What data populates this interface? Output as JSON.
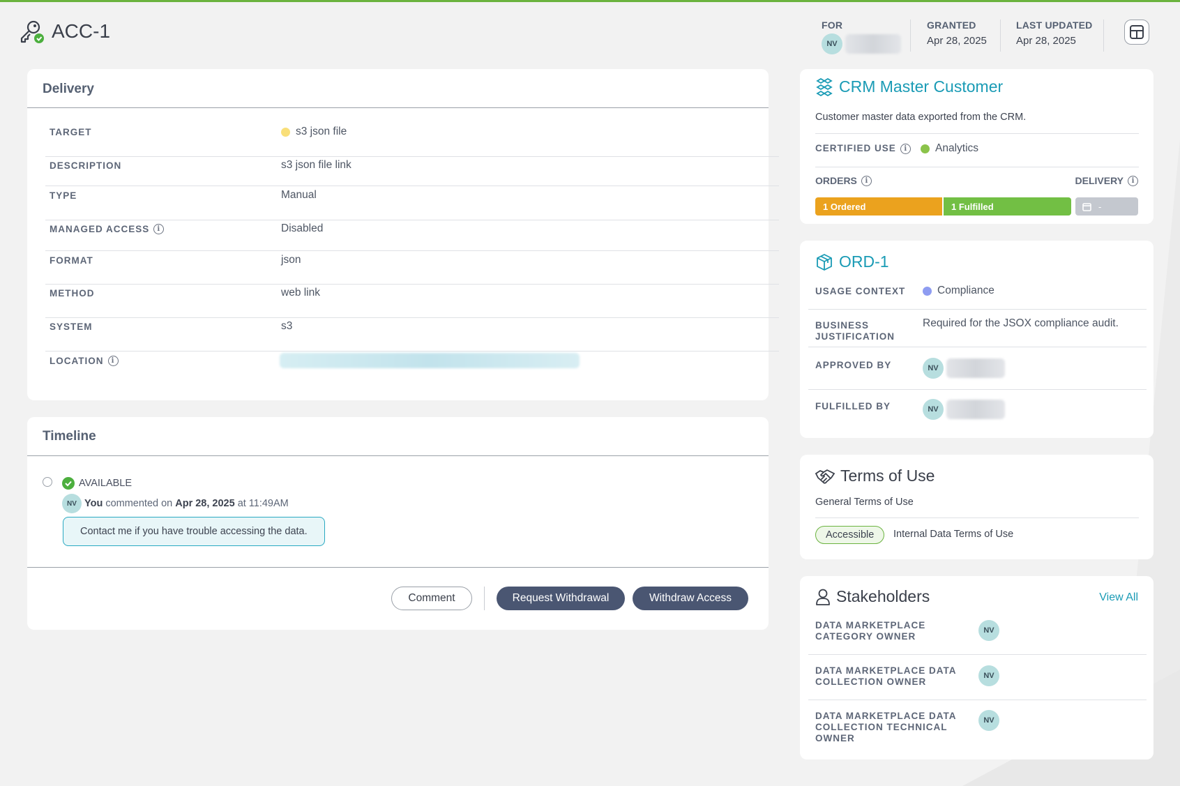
{
  "header": {
    "title": "ACC-1",
    "for_label": "FOR",
    "for_initials": "NV",
    "granted_label": "GRANTED",
    "granted_value": "Apr 28, 2025",
    "updated_label": "LAST UPDATED",
    "updated_value": "Apr 28, 2025"
  },
  "delivery": {
    "title": "Delivery",
    "rows": [
      {
        "label": "TARGET",
        "value": "s3 json file"
      },
      {
        "label": "DESCRIPTION",
        "value": "s3 json file link"
      },
      {
        "label": "TYPE",
        "value": "Manual"
      },
      {
        "label": "MANAGED ACCESS",
        "value": "Disabled"
      },
      {
        "label": "FORMAT",
        "value": "json"
      },
      {
        "label": "METHOD",
        "value": "web link"
      },
      {
        "label": "SYSTEM",
        "value": "s3"
      },
      {
        "label": "LOCATION",
        "value": ""
      }
    ]
  },
  "timeline": {
    "title": "Timeline",
    "status": "AVAILABLE",
    "initials": "NV",
    "author": "You",
    "action": "commented on",
    "date": "Apr 28, 2025",
    "at": "at",
    "time": "11:49AM",
    "comment": "Contact me if you have trouble accessing the data."
  },
  "actions": {
    "comment": "Comment",
    "request_withdrawal": "Request Withdrawal",
    "withdraw_access": "Withdraw Access"
  },
  "product": {
    "title": "CRM Master Customer",
    "description": "Customer master data exported from the CRM.",
    "certified_label": "CERTIFIED USE",
    "certified_value": "Analytics",
    "orders_label": "ORDERS",
    "delivery_label": "DELIVERY",
    "ordered_text": "1 Ordered",
    "fulfilled_text": "1 Fulfilled",
    "delivery_value": "-"
  },
  "order": {
    "title": "ORD-1",
    "usage_label": "USAGE CONTEXT",
    "usage_value": "Compliance",
    "justification_label_1": "BUSINESS",
    "justification_label_2": "JUSTIFICATION",
    "justification_value": "Required for the JSOX compliance audit.",
    "approved_label": "APPROVED BY",
    "fulfilled_label": "FULFILLED BY",
    "initials": "NV"
  },
  "terms": {
    "title": "Terms of Use",
    "general": "General Terms of Use",
    "badge": "Accessible",
    "internal": "Internal Data Terms of Use"
  },
  "stakeholders": {
    "title": "Stakeholders",
    "view_all": "View All",
    "items": [
      {
        "line1": "DATA MARKETPLACE",
        "line2": "CATEGORY OWNER",
        "line3": "",
        "initials": "NV"
      },
      {
        "line1": "DATA MARKETPLACE DATA",
        "line2": "COLLECTION OWNER",
        "line3": "",
        "initials": "NV"
      },
      {
        "line1": "DATA MARKETPLACE DATA",
        "line2": "COLLECTION TECHNICAL",
        "line3": "OWNER",
        "initials": "NV"
      }
    ]
  },
  "colors": {
    "accent": "#1a9bb5",
    "ordered": "#eba21e",
    "fulfilled": "#72bf44",
    "delivery_bar": "#c4c8cf",
    "button_dark": "#4a5672",
    "target_dot": "#f9df79",
    "analytics_dot": "#8bc34a",
    "compliance_dot": "#8e9cf1"
  }
}
